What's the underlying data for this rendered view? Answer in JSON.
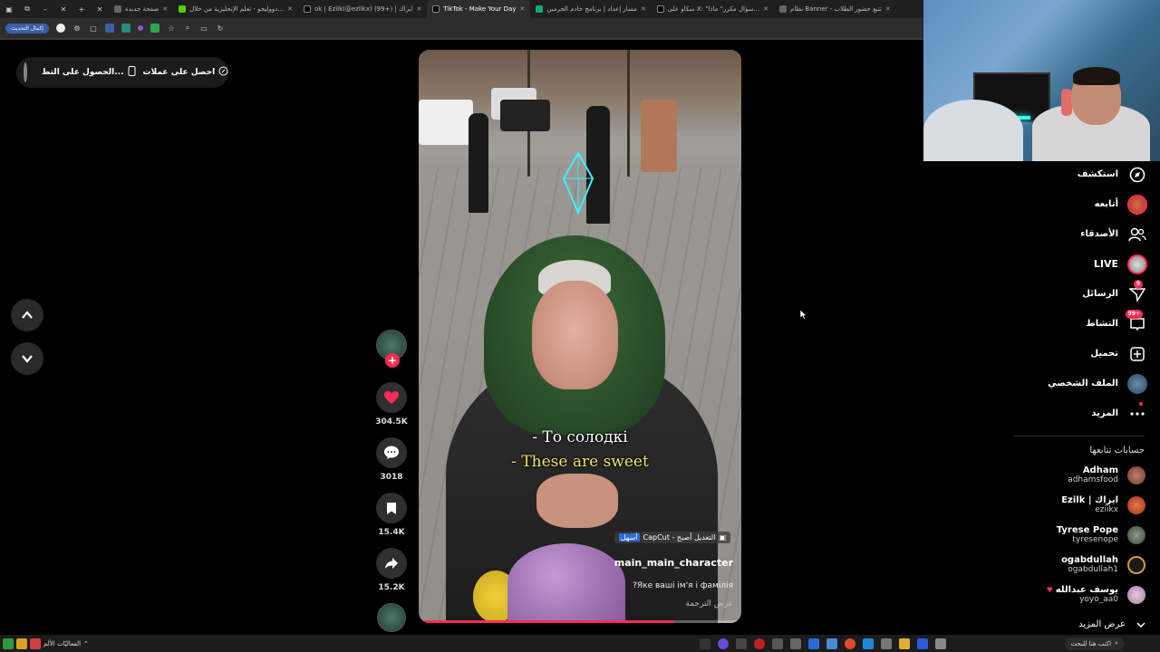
{
  "browser": {
    "tabs": [
      {
        "title": "نظام Banner - تتبع حضور الطلاب",
        "active": false
      },
      {
        "title": "صفحة جديدة",
        "active": false
      },
      {
        "title": "دووليجو - تعلم الإنجليزية من خلال...",
        "active": false
      },
      {
        "title": "ok | Ezilk(@ezlikx) (99+) | ايزاك",
        "active": false
      },
      {
        "title": "TikTok - Make Your Day",
        "active": true
      },
      {
        "title": "مسار إعداد | برنامج خادم الحرمين",
        "active": false
      },
      {
        "title": "سكاو على X: \"سؤال مكرر\" ماذا...",
        "active": false
      },
      {
        "title": "نظام Banner - تتبع حضور الطلاب",
        "active": false
      }
    ],
    "restart_label": "إكمال التحديث"
  },
  "top_pill": {
    "get_coins": "احصل على عملات",
    "get_app": "الحصول على التط..."
  },
  "video": {
    "subtitle_ukrainian": "- То солодкі",
    "subtitle_english": "- These are sweet",
    "capcut_prefix": "CapCut - التعديل أصبح",
    "capcut_highlight": "أسهل",
    "username": "main_main_character",
    "caption": "?Яке ваші ім'я і фамілія",
    "translate": "عرض الترجمة",
    "progress": 0.79
  },
  "actions": {
    "likes": "304.5K",
    "comments": "3018",
    "saves": "15.4K",
    "shares": "15.2K"
  },
  "sidebar": {
    "items": [
      {
        "label": "استكشف",
        "icon": "compass-icon"
      },
      {
        "label": "أتابعه",
        "icon": "following-avatar-icon"
      },
      {
        "label": "الأصدقاء",
        "icon": "friends-icon"
      },
      {
        "label": "LIVE",
        "icon": "live-avatar-icon"
      },
      {
        "label": "الرسائل",
        "icon": "send-icon",
        "badge": "9"
      },
      {
        "label": "النشاط",
        "icon": "inbox-icon",
        "badge": "99+"
      },
      {
        "label": "تحميل",
        "icon": "upload-icon"
      },
      {
        "label": "الملف الشخصي",
        "icon": "profile-avatar-icon"
      },
      {
        "label": "المزيد",
        "icon": "more-icon"
      }
    ],
    "following_title": "حسابات تتابعها",
    "accounts": [
      {
        "name": "Adham",
        "handle": "adhamsfood",
        "color": "#8a5a4a"
      },
      {
        "name": "Ezilk | ايزاك",
        "handle": "eziikx",
        "color": "#c04a2a"
      },
      {
        "name": "Tyrese Pope",
        "handle": "tyresenope",
        "color": "#5a6a5a"
      },
      {
        "name": "ogabdullah",
        "handle": "ogabdullah1",
        "color": "#3a3020"
      },
      {
        "name": "يوسف عبدالله",
        "handle": "yoyo_aa0",
        "color": "#c8a8c0"
      }
    ],
    "see_more": "عرض المزيد"
  },
  "taskbar": {
    "left_label": "الفعاليّات الألم",
    "search_placeholder": "اكتب هنا للبحث"
  },
  "colors": {
    "accent": "#fe2c55",
    "subtitle_yellow": "#f1e36b"
  }
}
